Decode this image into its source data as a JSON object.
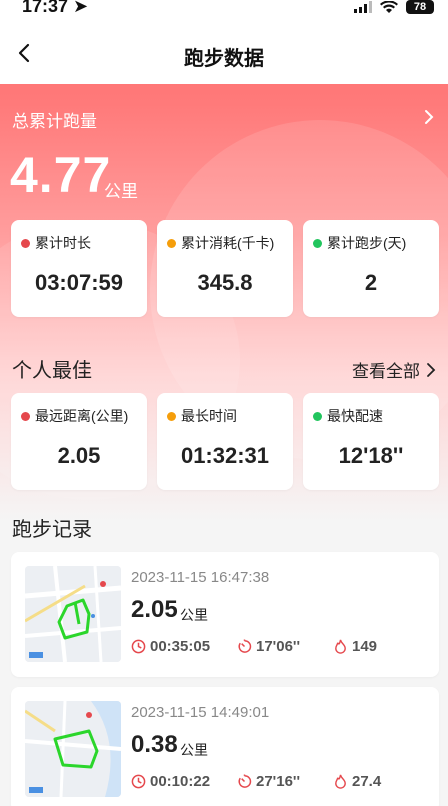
{
  "status": {
    "time": "17:37",
    "battery": "78"
  },
  "nav": {
    "title": "跑步数据"
  },
  "summary": {
    "label": "总累计跑量",
    "value": "4.77",
    "unit": "公里"
  },
  "stats": [
    {
      "label": "累计时长",
      "value": "03:07:59",
      "color": "#e5484d"
    },
    {
      "label": "累计消耗(千卡)",
      "value": "345.8",
      "color": "#f59e0b"
    },
    {
      "label": "累计跑步(天)",
      "value": "2",
      "color": "#22c55e"
    }
  ],
  "best": {
    "title": "个人最佳",
    "view_all": "查看全部",
    "items": [
      {
        "label": "最远距离(公里)",
        "value": "2.05",
        "color": "#e5484d"
      },
      {
        "label": "最长时间",
        "value": "01:32:31",
        "color": "#f59e0b"
      },
      {
        "label": "最快配速",
        "value": "12'18''",
        "color": "#22c55e"
      }
    ]
  },
  "records": {
    "title": "跑步记录",
    "items": [
      {
        "date": "2023-11-15 16:47:38",
        "distance": "2.05",
        "unit": "公里",
        "duration": "00:35:05",
        "pace": "17'06''",
        "calories": "149"
      },
      {
        "date": "2023-11-15 14:49:01",
        "distance": "0.38",
        "unit": "公里",
        "duration": "00:10:22",
        "pace": "27'16''",
        "calories": "27.4"
      }
    ]
  },
  "colors": {
    "accent": "#e5484d",
    "hero": "#ff6b6b"
  }
}
